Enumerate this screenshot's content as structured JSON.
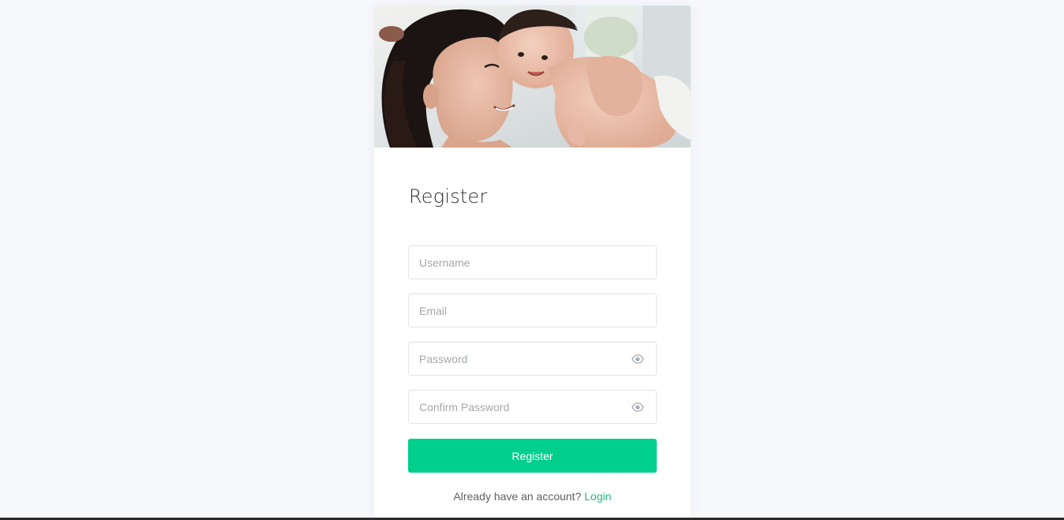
{
  "hero": {
    "image_label": "mother-and-baby-photo"
  },
  "form": {
    "title": "Register",
    "username_placeholder": "Username",
    "email_placeholder": "Email",
    "password_placeholder": "Password",
    "confirm_password_placeholder": "Confirm Password",
    "submit_label": "Register"
  },
  "footer": {
    "prompt_text": "Already have an account?",
    "login_link": "Login"
  },
  "colors": {
    "accent": "#00d08c",
    "link": "#20b87e",
    "background": "#f7f8fc"
  },
  "icons": {
    "password_toggle": "eye-icon",
    "confirm_toggle": "eye-icon"
  }
}
